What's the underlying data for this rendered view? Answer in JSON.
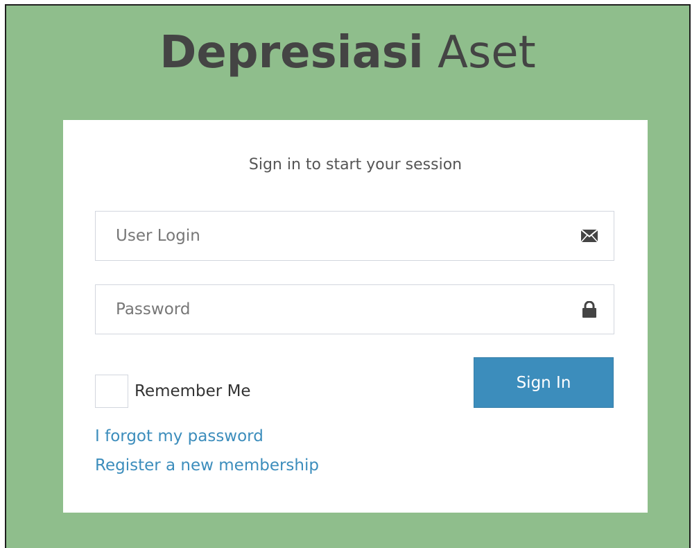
{
  "logo": {
    "bold_text": "Depresiasi",
    "light_text": "Aset"
  },
  "login": {
    "message": "Sign in to start your session",
    "user_field": {
      "value": "",
      "placeholder": "User Login",
      "icon": "envelope-icon"
    },
    "password_field": {
      "value": "",
      "placeholder": "Password",
      "icon": "lock-icon"
    },
    "remember_label": "Remember Me",
    "signin_label": "Sign In",
    "forgot_link": "I forgot my password",
    "register_link": "Register a new membership"
  },
  "colors": {
    "page_background": "#8fbe8c",
    "primary_button": "#3c8dbc",
    "link": "#3c8dbc",
    "logo_text": "#444444"
  }
}
